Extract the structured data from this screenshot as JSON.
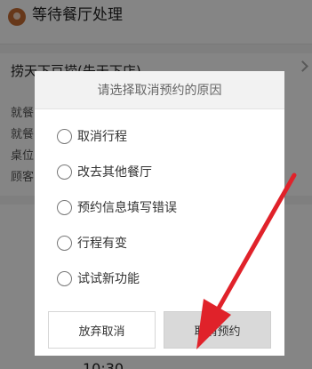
{
  "background": {
    "status_title": "等待餐厅处理",
    "restaurant_name": "捞天下豆捞(先天下店)",
    "info_rows": [
      "就餐",
      "就餐",
      "桌位",
      "顾客"
    ],
    "time_partial": "10:30"
  },
  "dialog": {
    "title": "请选择取消预约的原因",
    "options": [
      {
        "label": "取消行程"
      },
      {
        "label": "改去其他餐厅"
      },
      {
        "label": "预约信息填写错误"
      },
      {
        "label": "行程有变"
      },
      {
        "label": "试试新功能"
      }
    ],
    "cancel_button": "放弃取消",
    "confirm_button": "取消预约"
  },
  "colors": {
    "annotation_arrow": "#e0222a",
    "status_icon": "#c56b33"
  },
  "icons": {
    "status": "restaurant-status-icon",
    "chevron": "chevron-right-icon",
    "radio": "radio-unchecked-icon"
  }
}
